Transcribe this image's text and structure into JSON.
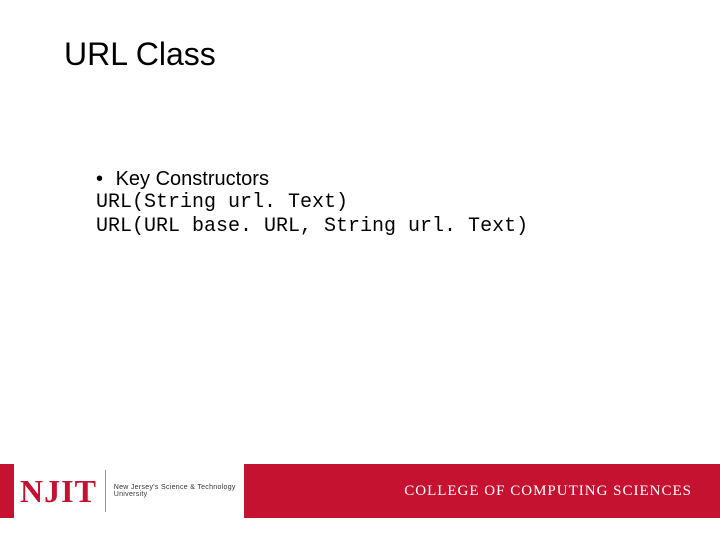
{
  "title": "URL Class",
  "bullet": {
    "label": "Key Constructors"
  },
  "code": {
    "line1": "URL(String url. Text)",
    "line2": "URL(URL base. URL, String url. Text)"
  },
  "footer": {
    "logo_text": "NJIT",
    "logo_sub": "New Jersey's Science & Technology University",
    "college": "COLLEGE OF COMPUTING SCIENCES"
  }
}
